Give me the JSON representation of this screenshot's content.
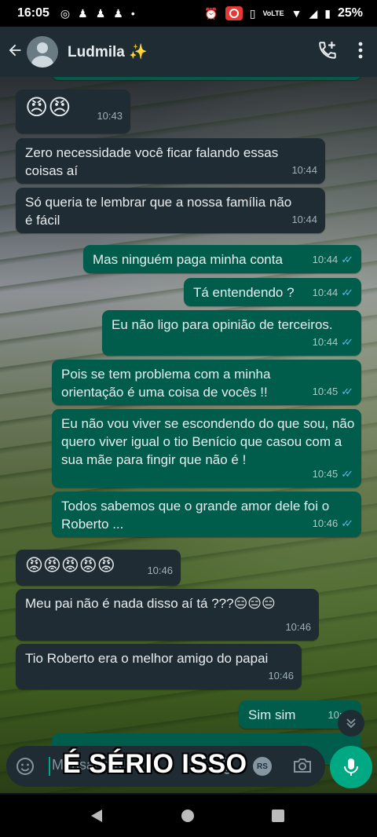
{
  "status_bar": {
    "time": "16:05",
    "battery": "25%",
    "network": "VoLTE",
    "notification_icons": [
      "ghost-icon",
      "ghost-icon",
      "ghost-icon",
      "dot-icon"
    ]
  },
  "header": {
    "contact_name": "Ludmila ✨"
  },
  "messages": [
    {
      "dir": "in",
      "text": "😠😠",
      "time": "10:43"
    },
    {
      "dir": "in",
      "text": "Zero necessidade você ficar falando essas coisas aí",
      "time": "10:44"
    },
    {
      "dir": "in",
      "text": "Só queria te lembrar que a nossa família não é fácil",
      "time": "10:44"
    },
    {
      "dir": "out",
      "text": "Mas ninguém paga minha conta",
      "time": "10:44"
    },
    {
      "dir": "out",
      "text": "Tá entendendo ?",
      "time": "10:44"
    },
    {
      "dir": "out",
      "text": "Eu não ligo para opinião de terceiros.",
      "time": "10:44"
    },
    {
      "dir": "out",
      "text": "Pois se tem problema com a minha orientação é uma coisa de vocês !!",
      "time": "10:45"
    },
    {
      "dir": "out",
      "text": "Eu não vou viver se escondendo do que sou, não quero viver igual o tio Benício que casou com a sua mãe para fingir que não é !",
      "time": "10:45"
    },
    {
      "dir": "out",
      "text": "Todos sabemos que o grande amor dele foi o Roberto ...",
      "time": "10:46"
    },
    {
      "dir": "in",
      "text": "😡😡😡😡😡",
      "time": "10:46"
    },
    {
      "dir": "in",
      "text": "Meu pai não é nada disso aí tá ???😑😑😑",
      "time": "10:46"
    },
    {
      "dir": "in",
      "text": "Tio Roberto era o melhor amigo do papai",
      "time": "10:46"
    },
    {
      "dir": "out",
      "text": "Sim sim",
      "time": "10:47"
    }
  ],
  "input": {
    "placeholder": "Mensagem"
  },
  "overlay_caption": "É SÉRIO ISSO",
  "rs_badge": "RS",
  "colors": {
    "incoming": "#1f2c34",
    "outgoing": "#005c4b",
    "accent": "#00a884",
    "read_tick": "#53bdeb"
  }
}
